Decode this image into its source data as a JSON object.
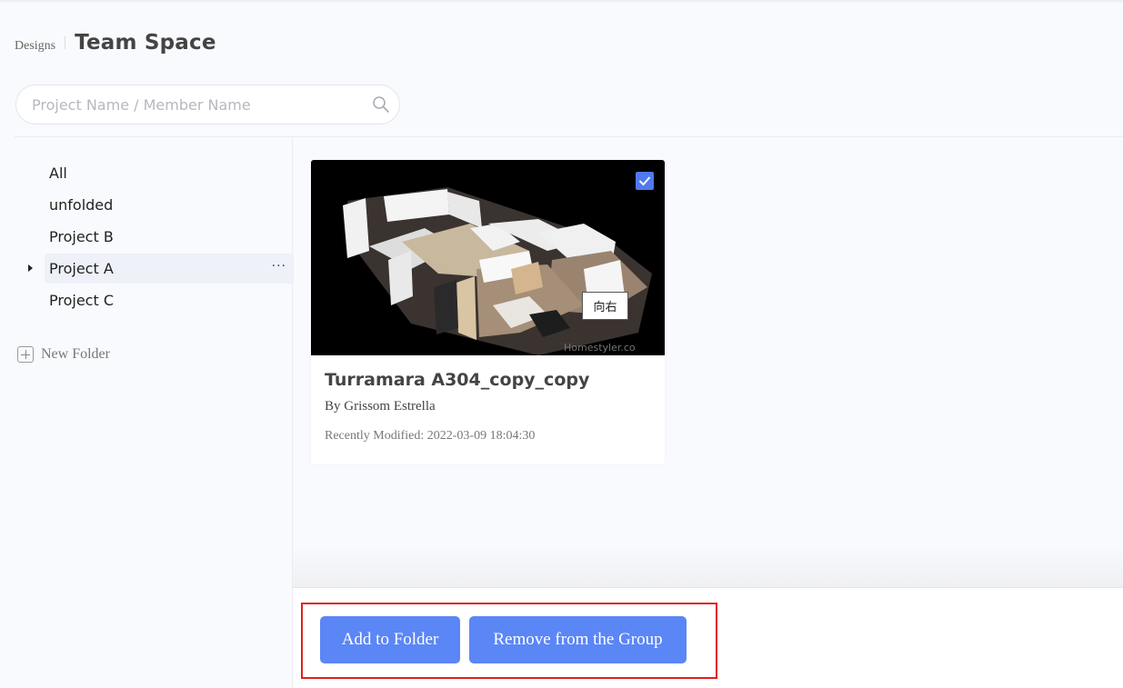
{
  "breadcrumb": {
    "parent": "Designs",
    "title": "Team Space"
  },
  "search": {
    "placeholder": "Project Name / Member Name",
    "value": ""
  },
  "sidebar": {
    "items": [
      {
        "label": "All",
        "active": false
      },
      {
        "label": "unfolded",
        "active": false
      },
      {
        "label": "Project B",
        "active": false
      },
      {
        "label": "Project A",
        "active": true,
        "has_children": true,
        "more": "···"
      },
      {
        "label": "Project C",
        "active": false
      }
    ],
    "new_folder_label": "New Folder"
  },
  "card": {
    "title": "Turramara A304_copy_copy",
    "author": "By Grissom Estrella",
    "modified": "Recently Modified: 2022-03-09 18:04:30",
    "selected": true,
    "tooltip": "向右",
    "thumbnail_icon": "floorplan-3d-render"
  },
  "actions": {
    "add_to_folder": "Add to Folder",
    "remove_from_group": "Remove from the Group"
  },
  "colors": {
    "accent": "#5b86f5",
    "checkbox": "#4f79ee",
    "highlight": "#e02020",
    "background": "#f9fafd"
  }
}
